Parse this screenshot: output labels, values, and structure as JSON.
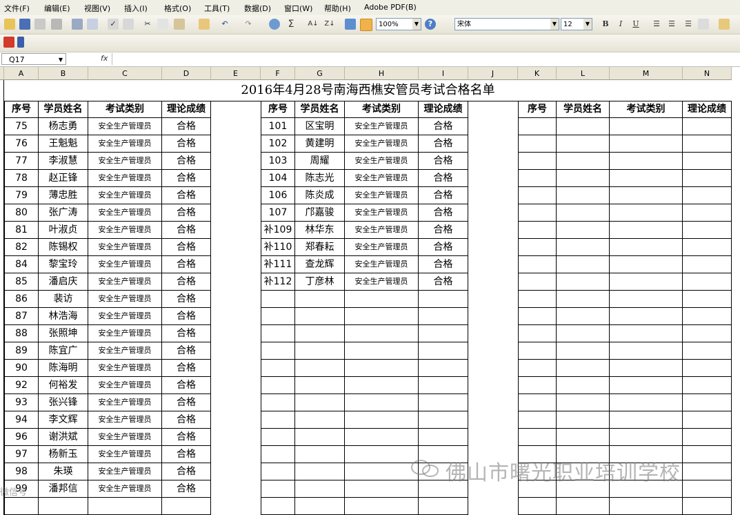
{
  "menu": [
    "文件(F)",
    "编辑(E)",
    "视图(V)",
    "插入(I)",
    "格式(O)",
    "工具(T)",
    "数据(D)",
    "窗口(W)",
    "帮助(H)",
    "Adobe PDF(B)"
  ],
  "toolbar": {
    "zoom": "100%",
    "font_name": "宋体",
    "font_size": "12"
  },
  "formula_bar": {
    "name_box": "Q17",
    "fx": "fx"
  },
  "columns": [
    "A",
    "B",
    "C",
    "D",
    "E",
    "F",
    "G",
    "H",
    "I",
    "J",
    "K",
    "L",
    "M",
    "N"
  ],
  "sheet": {
    "title": "2016年4月28号南海西樵安管员考试合格名单",
    "headers": [
      "序号",
      "学员姓名",
      "考试类别",
      "理论成绩"
    ],
    "block1": [
      [
        "75",
        "杨志勇",
        "安全生产管理员",
        "合格"
      ],
      [
        "76",
        "王魁魁",
        "安全生产管理员",
        "合格"
      ],
      [
        "77",
        "李淑慧",
        "安全生产管理员",
        "合格"
      ],
      [
        "78",
        "赵正锋",
        "安全生产管理员",
        "合格"
      ],
      [
        "79",
        "薄忠胜",
        "安全生产管理员",
        "合格"
      ],
      [
        "80",
        "张广涛",
        "安全生产管理员",
        "合格"
      ],
      [
        "81",
        "叶淑贞",
        "安全生产管理员",
        "合格"
      ],
      [
        "82",
        "陈锡权",
        "安全生产管理员",
        "合格"
      ],
      [
        "84",
        "黎宝玲",
        "安全生产管理员",
        "合格"
      ],
      [
        "85",
        "潘启庆",
        "安全生产管理员",
        "合格"
      ],
      [
        "86",
        "裴访",
        "安全生产管理员",
        "合格"
      ],
      [
        "87",
        "林浩海",
        "安全生产管理员",
        "合格"
      ],
      [
        "88",
        "张照坤",
        "安全生产管理员",
        "合格"
      ],
      [
        "89",
        "陈宜广",
        "安全生产管理员",
        "合格"
      ],
      [
        "90",
        "陈海明",
        "安全生产管理员",
        "合格"
      ],
      [
        "92",
        "何裕发",
        "安全生产管理员",
        "合格"
      ],
      [
        "93",
        "张兴锋",
        "安全生产管理员",
        "合格"
      ],
      [
        "94",
        "李文辉",
        "安全生产管理员",
        "合格"
      ],
      [
        "96",
        "谢洪斌",
        "安全生产管理员",
        "合格"
      ],
      [
        "97",
        "杨新玉",
        "安全生产管理员",
        "合格"
      ],
      [
        "98",
        "朱瑛",
        "安全生产管理员",
        "合格"
      ],
      [
        "99",
        "潘邦信",
        "安全生产管理员",
        "合格"
      ]
    ],
    "block2": [
      [
        "101",
        "区宝明",
        "安全生产管理员",
        "合格"
      ],
      [
        "102",
        "黄建明",
        "安全生产管理员",
        "合格"
      ],
      [
        "103",
        "周耀",
        "安全生产管理员",
        "合格"
      ],
      [
        "104",
        "陈志光",
        "安全生产管理员",
        "合格"
      ],
      [
        "106",
        "陈炎成",
        "安全生产管理员",
        "合格"
      ],
      [
        "107",
        "邝嘉骏",
        "安全生产管理员",
        "合格"
      ],
      [
        "补109",
        "林华东",
        "安全生产管理员",
        "合格"
      ],
      [
        "补110",
        "郑春耘",
        "安全生产管理员",
        "合格"
      ],
      [
        "补111",
        "查龙辉",
        "安全生产管理员",
        "合格"
      ],
      [
        "补112",
        "丁彦林",
        "安全生产管理员",
        "合格"
      ]
    ]
  },
  "watermark": "佛山市曙光职业培训学校",
  "watermark_small": "微信号"
}
